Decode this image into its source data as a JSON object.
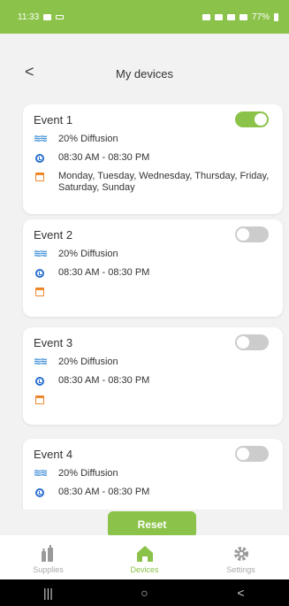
{
  "status": {
    "time": "11:33",
    "right": "77%"
  },
  "header": {
    "back": "<",
    "title": "My devices"
  },
  "events": [
    {
      "name": "Event 1",
      "enabled": true,
      "diffusion": "20% Diffusion",
      "time": "08:30 AM - 08:30 PM",
      "days": "Monday, Tuesday, Wednesday, Thursday, Friday, Saturday, Sunday"
    },
    {
      "name": "Event 2",
      "enabled": false,
      "diffusion": "20% Diffusion",
      "time": "08:30 AM - 08:30 PM",
      "days": ""
    },
    {
      "name": "Event 3",
      "enabled": false,
      "diffusion": "20% Diffusion",
      "time": "08:30 AM - 08:30 PM",
      "days": ""
    },
    {
      "name": "Event 4",
      "enabled": false,
      "diffusion": "20% Diffusion",
      "time": "08:30 AM - 08:30 PM",
      "days": ""
    }
  ],
  "reset_label": "Reset",
  "nav": {
    "supplies": "Supplies",
    "devices": "Devices",
    "settings": "Settings"
  },
  "sys_nav": {
    "recents": "|||",
    "home": "○",
    "back": "<"
  },
  "colors": {
    "accent": "#8bc34a",
    "clock": "#2a6fcf",
    "calendar": "#f0862a",
    "diffusion": "#3f8fd8"
  },
  "icons": {
    "diffusion": "diffusion-waves-icon",
    "clock": "clock-icon",
    "calendar": "calendar-icon",
    "supplies": "bottles-icon",
    "devices": "home-icon",
    "settings": "gear-icon"
  }
}
